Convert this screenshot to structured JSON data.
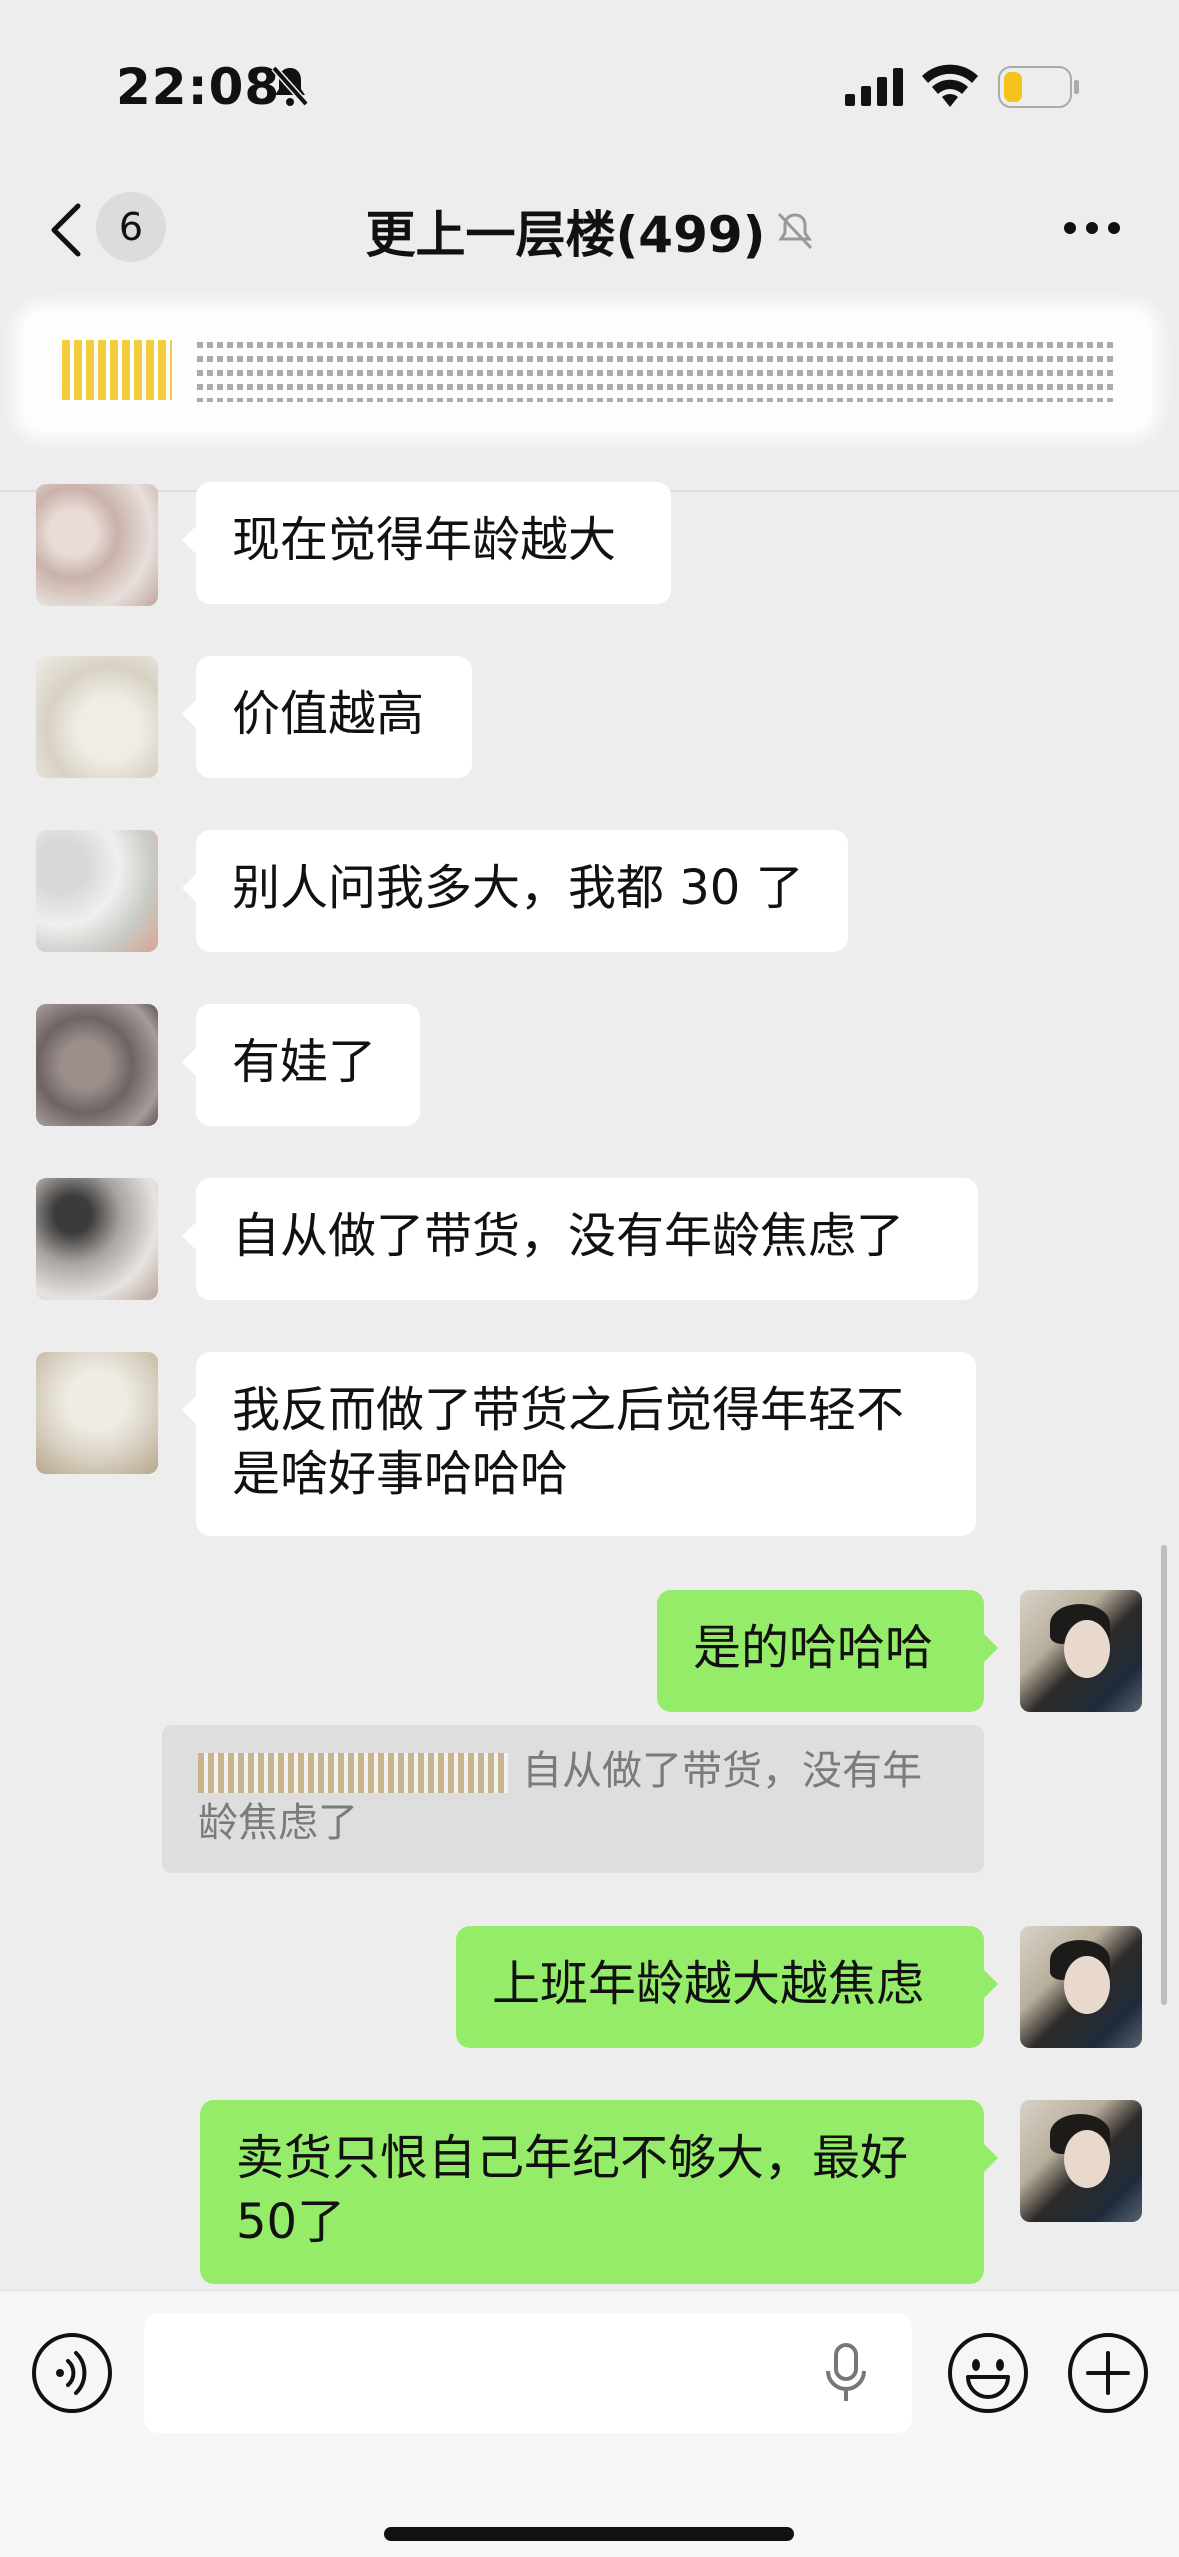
{
  "status_bar": {
    "time": "22:08"
  },
  "nav": {
    "unread_count": "6",
    "title": "更上一层楼(499)"
  },
  "messages": [
    {
      "text": "现在觉得年龄越大"
    },
    {
      "text": "价值越高"
    },
    {
      "text": "别人问我多大，我都 30 了"
    },
    {
      "text": "有娃了"
    },
    {
      "text": "自从做了带货，没有年龄焦虑了"
    },
    {
      "text": "我反而做了带货之后觉得年轻不是啥好事哈哈哈"
    },
    {
      "text": "是的哈哈哈"
    },
    {
      "text": "自从做了带货，没有年龄焦虑了"
    },
    {
      "text": "上班年龄越大越焦虑"
    },
    {
      "text": "卖货只恨自己年纪不够大，最好50了"
    }
  ],
  "icons": [
    "mute-bell-icon",
    "signal-icon",
    "wifi-icon",
    "battery-icon",
    "back-icon",
    "muted-bell-icon",
    "more-icon",
    "voice-icon",
    "mic-icon",
    "emoji-icon",
    "plus-icon"
  ],
  "colors": {
    "self_bubble": "#95ec69",
    "other_bubble": "#ffffff",
    "background": "#ededed"
  }
}
